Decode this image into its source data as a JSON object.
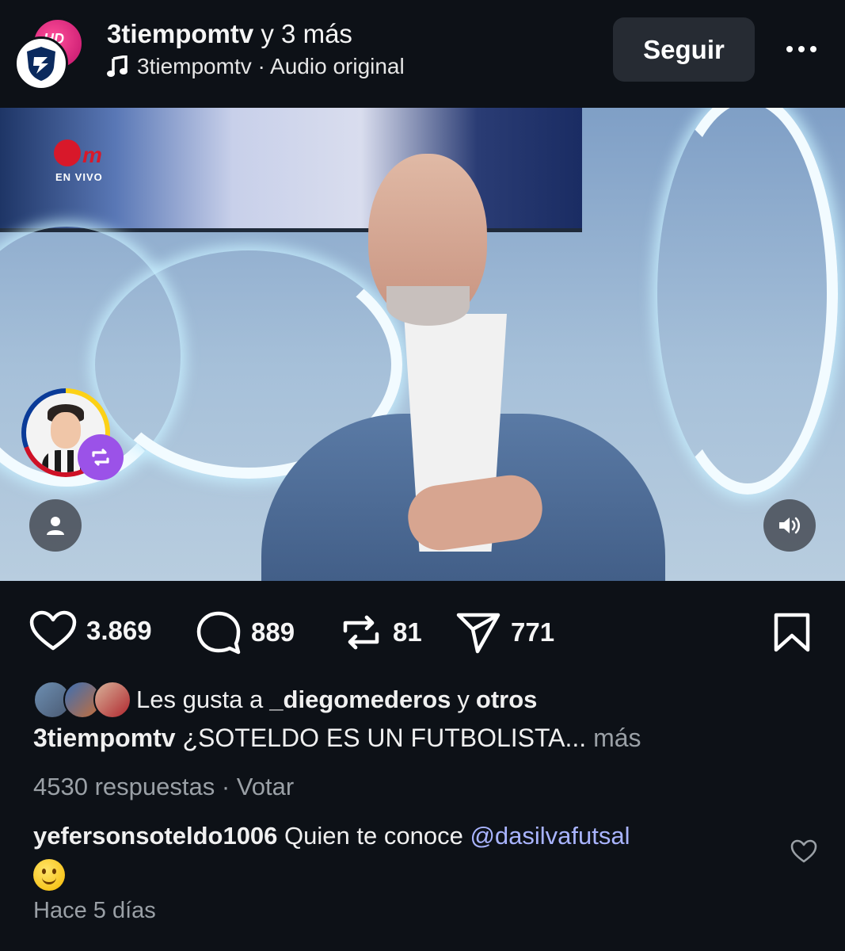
{
  "header": {
    "author": "3tiempomtv",
    "and_more": "y 3 más",
    "audio_icon": "music-note-icon",
    "audio": "3tiempomtv · Audio original",
    "follow_label": "Seguir",
    "avatar_back_text": "HD"
  },
  "video": {
    "overlay_logo_text": "EN VIVO",
    "buttons": [
      "tag-people-icon",
      "volume-icon"
    ]
  },
  "actions": {
    "likes": "3.869",
    "comments": "889",
    "reposts": "81",
    "shares": "771"
  },
  "liked_by": {
    "prefix": "Les gusta a",
    "user": "_diegomederos",
    "connector": "y",
    "others": "otros"
  },
  "caption": {
    "user": "3tiempomtv",
    "text": "¿SOTELDO ES UN FUTBOLISTA...",
    "more": "más"
  },
  "poll": {
    "responses": "4530 respuestas",
    "separator": "·",
    "vote": "Votar"
  },
  "comment": {
    "user": "yefersonsoteldo1006",
    "text": "Quien te conoce",
    "mention": "@dasilvafutsal",
    "emoji": "slightly-smiling-face"
  },
  "time": "Hace 5 días",
  "colors": {
    "background": "#0d1117",
    "button": "#262b33",
    "mention": "#a9b4ff",
    "repost_badge": "#9b52e8"
  }
}
